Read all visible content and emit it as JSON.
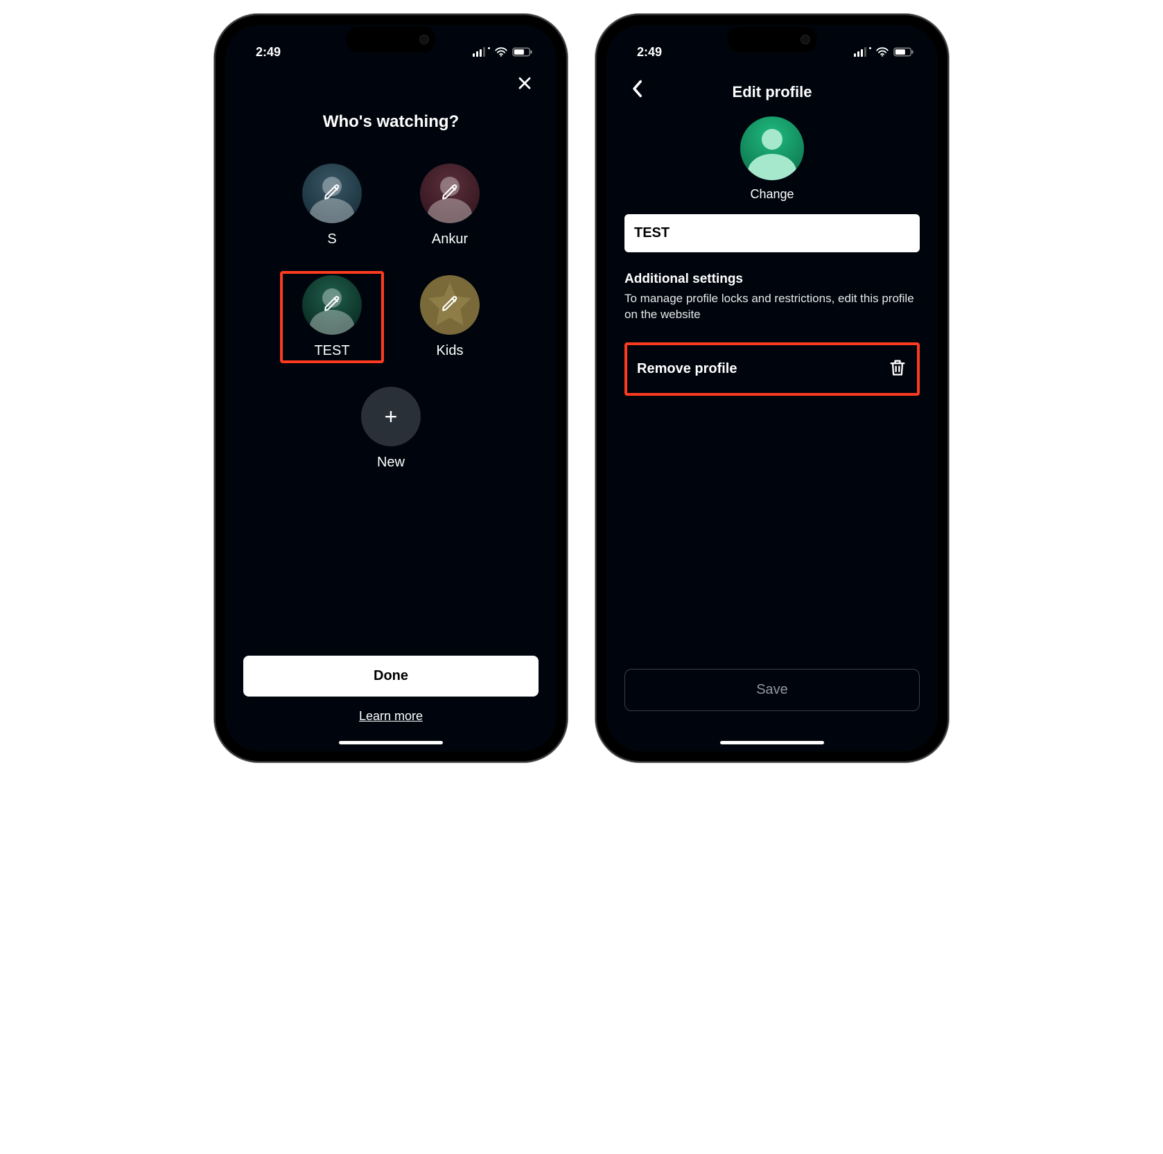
{
  "status": {
    "time": "2:49"
  },
  "screen1": {
    "title": "Who's watching?",
    "profiles": [
      {
        "name": "S"
      },
      {
        "name": "Ankur"
      },
      {
        "name": "TEST"
      },
      {
        "name": "Kids"
      }
    ],
    "new_label": "New",
    "done_label": "Done",
    "learn_more_label": "Learn more"
  },
  "screen2": {
    "title": "Edit profile",
    "change_label": "Change",
    "name_value": "TEST",
    "additional_settings_title": "Additional settings",
    "additional_settings_desc": "To manage profile locks and restrictions, edit this profile on the website",
    "remove_label": "Remove profile",
    "save_label": "Save"
  }
}
